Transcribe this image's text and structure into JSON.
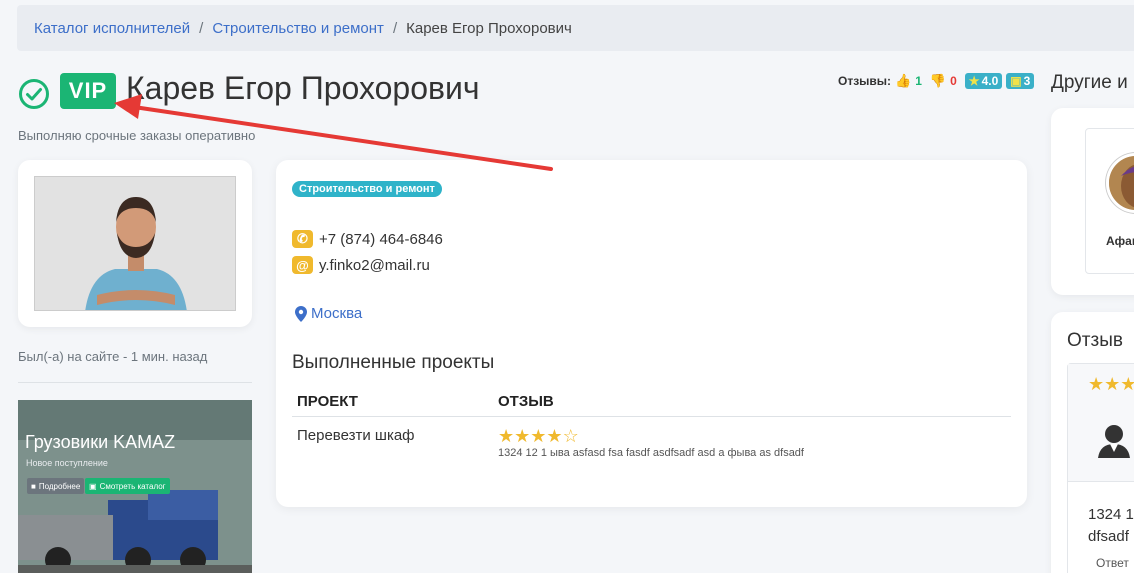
{
  "breadcrumb": {
    "items": [
      "Каталог исполнителей",
      "Строительство и ремонт"
    ],
    "separator": "/",
    "current": "Карев Егор Прохорович"
  },
  "profile": {
    "badge": "VIP",
    "name": "Карев Егор Прохорович",
    "tagline": "Выполняю срочные заказы оперативно",
    "last_seen": "Был(-а) на сайте - 1 мин. назад"
  },
  "reviews_summary": {
    "label": "Отзывы:",
    "positive": "1",
    "negative": "0",
    "rating": "4.0",
    "count": "3",
    "colors": {
      "positive": "#1bb574",
      "negative": "#e53935",
      "badge": "#3ab0c8"
    }
  },
  "others": {
    "title": "Другие и"
  },
  "main": {
    "category": "Строительство и ремонт",
    "phone": "+7 (874) 464-6846",
    "email": "y.finko2@mail.ru",
    "city": "Москва",
    "projects_title": "Выполненные проекты",
    "table": {
      "headers": [
        "ПРОЕКТ",
        "ОТЗЫВ"
      ],
      "rows": [
        {
          "project": "Перевезти шкаф",
          "rating": 4,
          "max_rating": 5,
          "review": "1324 12 1 ыва asfasd fsa fasdf asdfsadf asd а фыва as dfsadf"
        }
      ]
    }
  },
  "ad": {
    "title": "Грузовики KAMAZ",
    "subtitle": "Новое поступление",
    "button_more": "Подробнее",
    "button_catalog": "Смотреть каталог"
  },
  "side_card": {
    "name": "Афана"
  },
  "side_reviews": {
    "title": "Отзыв",
    "rating": 3,
    "text_line1": "1324 1",
    "text_line2": "dfsadf",
    "answer": "Ответ"
  }
}
